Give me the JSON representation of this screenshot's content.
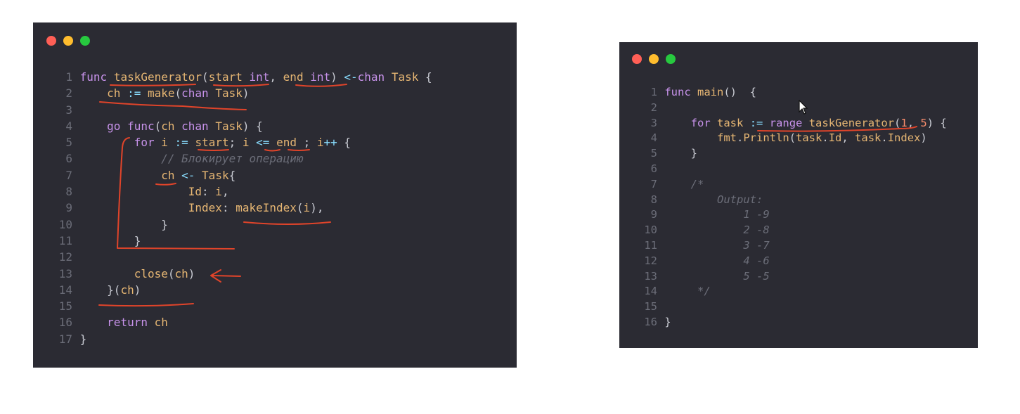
{
  "left_window": {
    "lines": [
      {
        "num": "1",
        "html": "<span style='color:#c792ea'>func</span> <span style='color:#e6b673'>taskGenerator</span>(<span style='color:#e6b673'>start</span> <span style='color:#c792ea'>int</span>, <span style='color:#e6b673'>end</span> <span style='color:#c792ea'>int</span>) <span style='color:#89ddff'>&lt;-</span><span style='color:#c792ea'>chan</span> <span style='color:#e6b673'>Task</span> {"
      },
      {
        "num": "2",
        "html": "    <span style='color:#e6b673'>ch</span> <span style='color:#89ddff'>:=</span> <span style='color:#e6b673'>make</span>(<span style='color:#c792ea'>chan</span> <span style='color:#e6b673'>Task</span>)"
      },
      {
        "num": "3",
        "html": ""
      },
      {
        "num": "4",
        "html": "    <span style='color:#c792ea'>go</span> <span style='color:#c792ea'>func</span>(<span style='color:#e6b673'>ch</span> <span style='color:#c792ea'>chan</span> <span style='color:#e6b673'>Task</span>) {"
      },
      {
        "num": "5",
        "html": "        <span style='color:#c792ea'>for</span> <span style='color:#e6b673'>i</span> <span style='color:#89ddff'>:=</span> <span style='color:#e6b673'>start</span>; <span style='color:#e6b673'>i</span> <span style='color:#89ddff'>&lt;=</span> <span style='color:#e6b673'>end</span> ; <span style='color:#e6b673'>i</span><span style='color:#89ddff'>++</span> {"
      },
      {
        "num": "6",
        "html": "            <span style='color:#6b6d78;font-style:italic'>// Блокирует операцию</span>"
      },
      {
        "num": "7",
        "html": "            <span style='color:#e6b673'>ch</span> <span style='color:#89ddff'>&lt;-</span> <span style='color:#e6b673'>Task</span>{"
      },
      {
        "num": "8",
        "html": "                <span style='color:#e6b673'>Id</span>: <span style='color:#e6b673'>i</span>,"
      },
      {
        "num": "9",
        "html": "                <span style='color:#e6b673'>Index</span>: <span style='color:#e6b673'>makeIndex</span>(<span style='color:#e6b673'>i</span>),"
      },
      {
        "num": "10",
        "html": "            }"
      },
      {
        "num": "11",
        "html": "        }"
      },
      {
        "num": "12",
        "html": ""
      },
      {
        "num": "13",
        "html": "        <span style='color:#e6b673'>close</span>(<span style='color:#e6b673'>ch</span>)"
      },
      {
        "num": "14",
        "html": "    }(<span style='color:#e6b673'>ch</span>)"
      },
      {
        "num": "15",
        "html": ""
      },
      {
        "num": "16",
        "html": "    <span style='color:#c792ea'>return</span> <span style='color:#e6b673'>ch</span>"
      },
      {
        "num": "17",
        "html": "}"
      }
    ]
  },
  "right_window": {
    "lines": [
      {
        "num": "1",
        "html": "<span style='color:#c792ea'>func</span> <span style='color:#e6b673'>main</span>()  {"
      },
      {
        "num": "2",
        "html": ""
      },
      {
        "num": "3",
        "html": "    <span style='color:#c792ea'>for</span> <span style='color:#e6b673'>task</span> <span style='color:#89ddff'>:=</span> <span style='color:#c792ea'>range</span> <span style='color:#e6b673'>taskGenerator</span>(<span style='color:#f78c6c'>1</span>, <span style='color:#f78c6c'>5</span>) {"
      },
      {
        "num": "4",
        "html": "        <span style='color:#e6b673'>fmt</span>.<span style='color:#e6b673'>Println</span>(<span style='color:#e6b673'>task</span>.<span style='color:#e6b673'>Id</span>, <span style='color:#e6b673'>task</span>.<span style='color:#e6b673'>Index</span>)"
      },
      {
        "num": "5",
        "html": "    }"
      },
      {
        "num": "6",
        "html": ""
      },
      {
        "num": "7",
        "html": "    <span style='color:#6b6d78;font-style:italic'>/*</span>"
      },
      {
        "num": "8",
        "html": "        <span style='color:#6b6d78;font-style:italic'>Output:</span>"
      },
      {
        "num": "9",
        "html": "            <span style='color:#6b6d78;font-style:italic'>1 -9</span>"
      },
      {
        "num": "10",
        "html": "            <span style='color:#6b6d78;font-style:italic'>2 -8</span>"
      },
      {
        "num": "11",
        "html": "            <span style='color:#6b6d78;font-style:italic'>3 -7</span>"
      },
      {
        "num": "12",
        "html": "            <span style='color:#6b6d78;font-style:italic'>4 -6</span>"
      },
      {
        "num": "13",
        "html": "            <span style='color:#6b6d78;font-style:italic'>5 -5</span>"
      },
      {
        "num": "14",
        "html": "     <span style='color:#6b6d78;font-style:italic'>*/</span>"
      },
      {
        "num": "15",
        "html": ""
      },
      {
        "num": "16",
        "html": "}"
      }
    ]
  },
  "colors": {
    "window_bg": "#2b2b33",
    "annotation": "#e0442a",
    "keyword": "#c792ea",
    "identifier": "#e6b673",
    "operator": "#89ddff",
    "comment": "#6b6d78"
  }
}
